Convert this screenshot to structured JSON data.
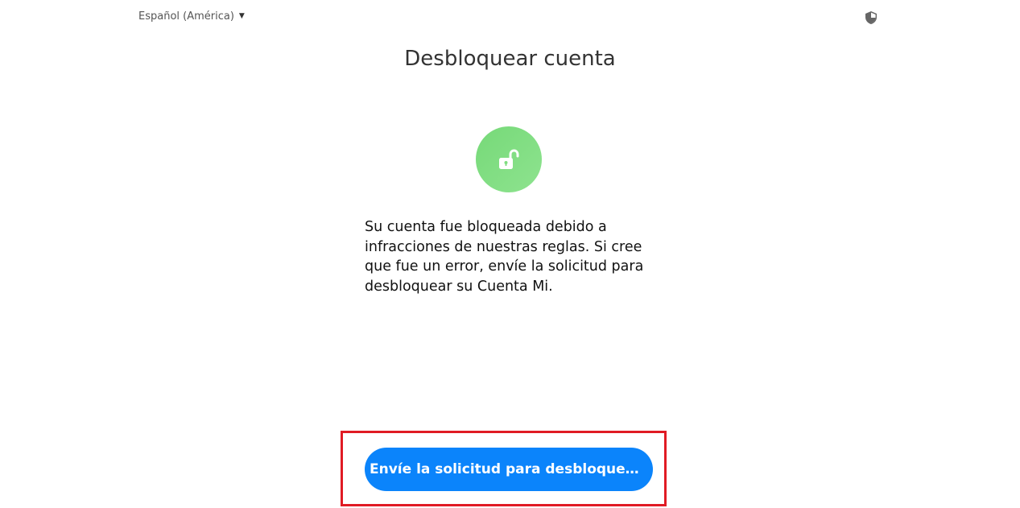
{
  "header": {
    "language_label": "Español (América)",
    "language_caret_icon": "caret-down-icon",
    "security_icon": "shield-icon"
  },
  "main": {
    "title": "Desbloquear cuenta",
    "status_icon": "unlock-icon",
    "message": "Su cuenta fue bloqueada debido a infracciones de nuestras reglas. Si cree que fue un error, envíe la solicitud para desbloquear su Cuenta Mi.",
    "submit_button_label": "Envíe la solicitud para desbloquear s..."
  },
  "colors": {
    "accent_button": "#0b84fb",
    "icon_circle": "#7fdd7f",
    "highlight_border": "#e01b24",
    "title_text": "#333333"
  }
}
